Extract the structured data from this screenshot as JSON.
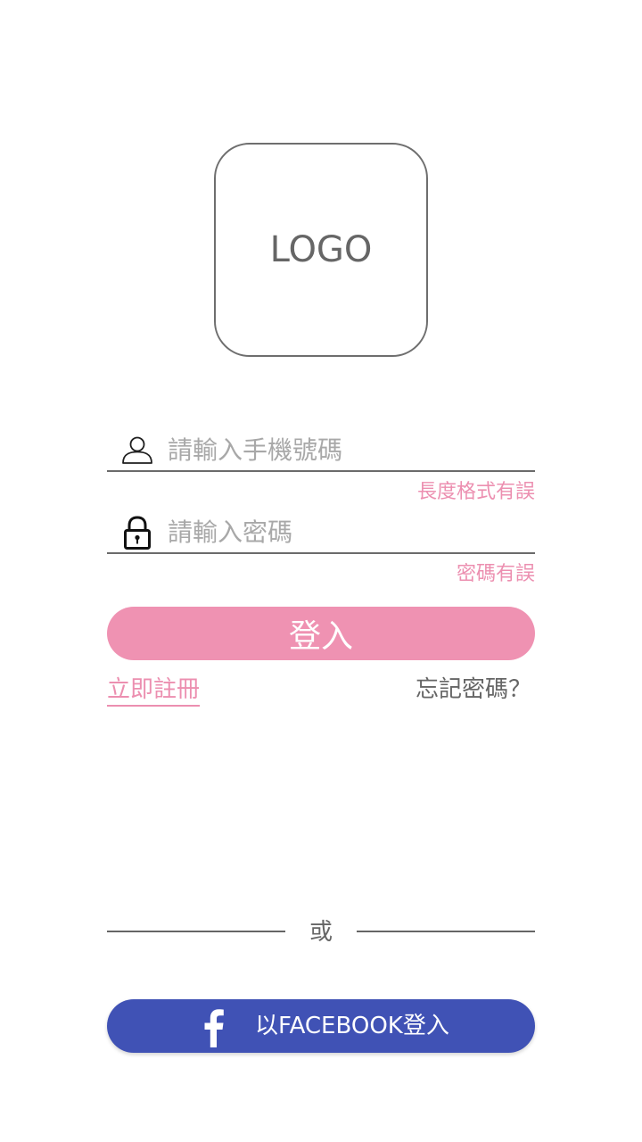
{
  "logo": {
    "text": "LOGO"
  },
  "form": {
    "phone": {
      "icon": "user-icon",
      "placeholder": "請輸入手機號碼",
      "value": "",
      "error": "長度格式有誤"
    },
    "password": {
      "icon": "lock-icon",
      "placeholder": "請輸入密碼",
      "value": "",
      "error": "密碼有誤"
    },
    "login_label": "登入"
  },
  "links": {
    "register": "立即註冊",
    "forgot_password": "忘記密碼？"
  },
  "divider": {
    "text": "或"
  },
  "facebook": {
    "icon": "facebook-icon",
    "label": "以FACEBOOK登入"
  },
  "colors": {
    "accent_pink": "#ef92b2",
    "error_pink": "#ec8fb0",
    "facebook_blue": "#4052b5",
    "text_gray": "#666666",
    "placeholder_gray": "#a8a8a8"
  }
}
